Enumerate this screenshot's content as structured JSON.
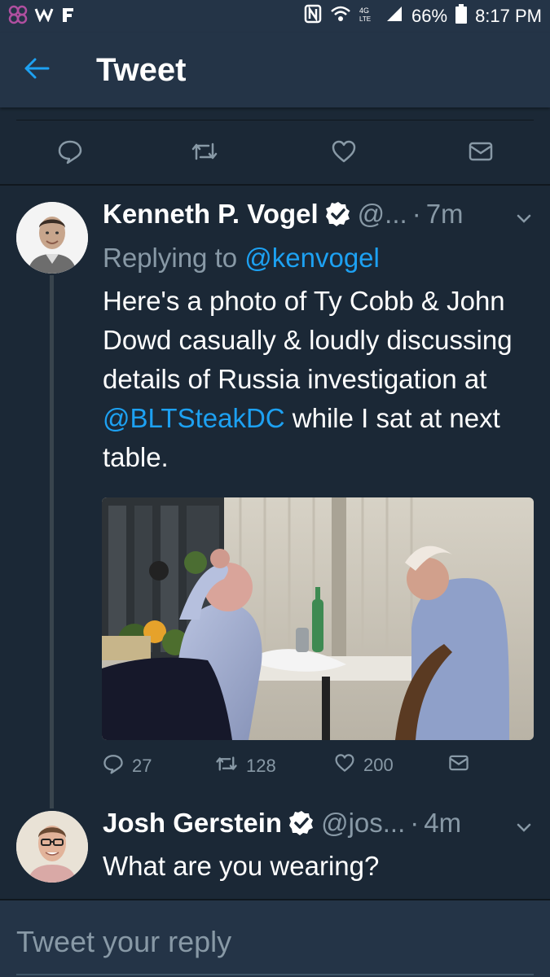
{
  "status_bar": {
    "battery": "66%",
    "time": "8:17 PM",
    "left_icons": [
      "flower-app-icon",
      "w-app-icon",
      "f-app-icon"
    ],
    "right_icons": [
      "nfc-icon",
      "wifi-icon",
      "lte-icon",
      "signal-icon",
      "battery-icon"
    ]
  },
  "header": {
    "title": "Tweet",
    "back_icon": "back-arrow-icon",
    "accent": "#1da1f2"
  },
  "top_actions": [
    "reply-icon",
    "retweet-icon",
    "like-icon",
    "message-icon"
  ],
  "tweets": [
    {
      "author": "Kenneth P. Vogel",
      "verified": true,
      "handle": "@...",
      "time": "7m",
      "replying_prefix": "Replying to ",
      "replying_to": "@kenvogel",
      "text_before": "Here's a photo of Ty Cobb & John Dowd casually & loudly discussing details of Russia investigation at ",
      "mention": "@BLTSteakDC",
      "text_after": " while I sat at next table.",
      "stats": {
        "replies": "27",
        "retweets": "128",
        "likes": "200"
      }
    },
    {
      "author": "Josh Gerstein",
      "verified": true,
      "handle": "@jos...",
      "time": "4m",
      "text": "What are you wearing?"
    }
  ],
  "reply_box": {
    "placeholder": "Tweet your reply"
  },
  "colors": {
    "background": "#1b2836",
    "bar": "#243447",
    "muted": "#8899a6",
    "link": "#1da1f2"
  }
}
